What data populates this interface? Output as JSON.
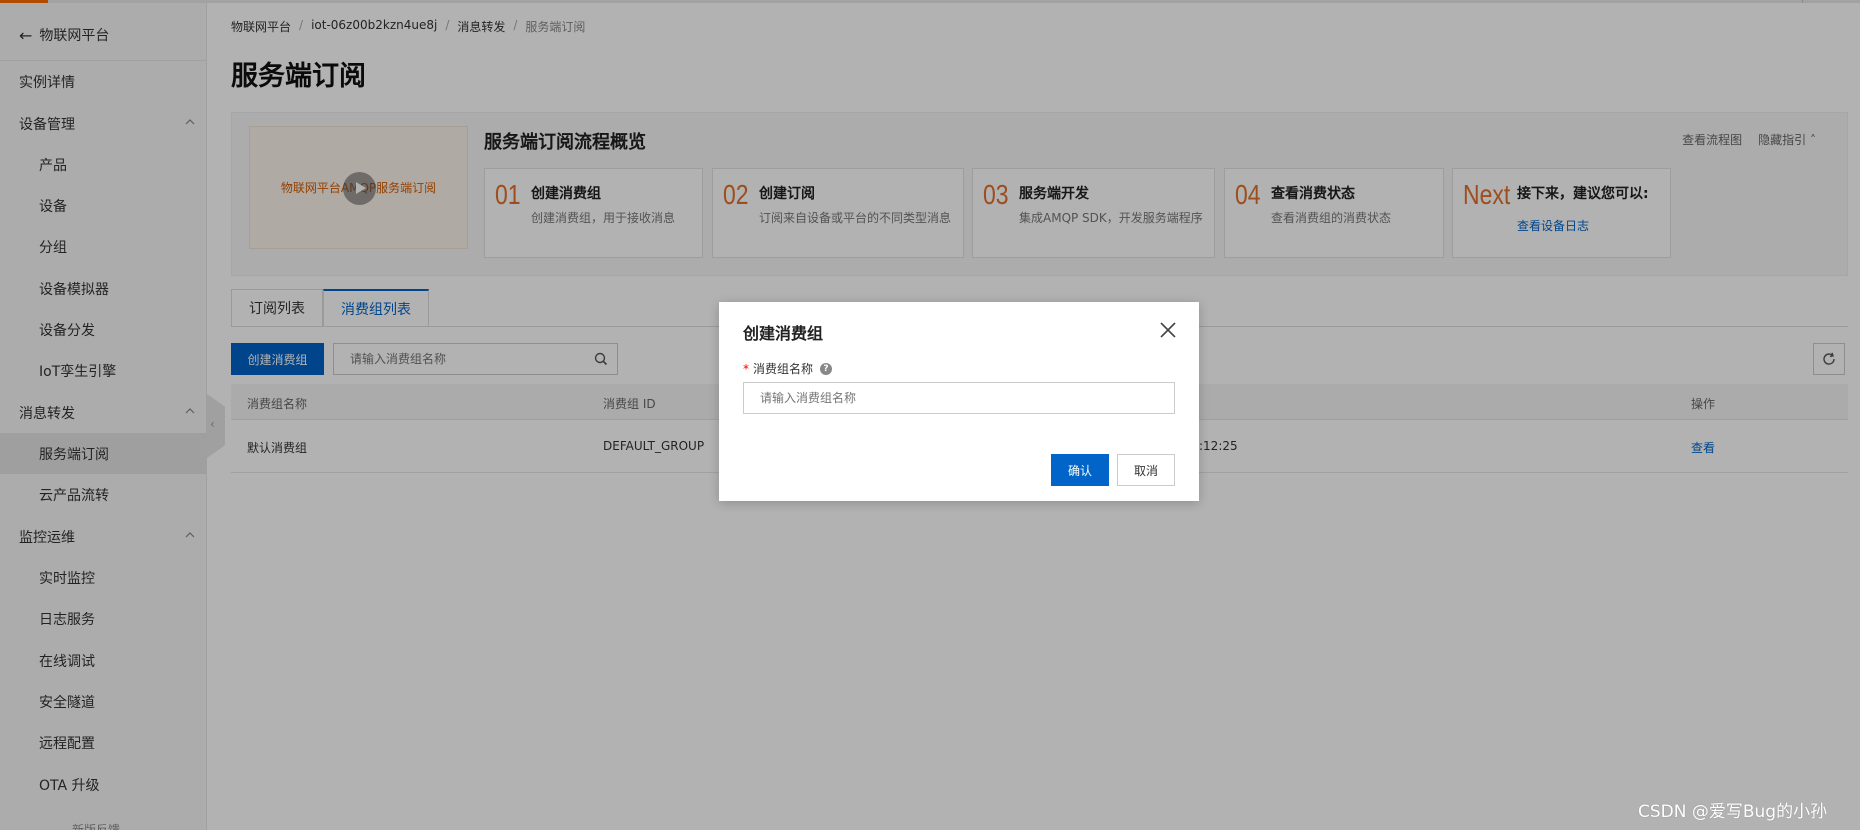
{
  "sidebar": {
    "back_label": "物联网平台",
    "items": [
      {
        "label": "实例详情"
      },
      {
        "label": "设备管理"
      },
      {
        "label": "产品"
      },
      {
        "label": "设备"
      },
      {
        "label": "分组"
      },
      {
        "label": "设备模拟器"
      },
      {
        "label": "设备分发"
      },
      {
        "label": "IoT孪生引擎"
      },
      {
        "label": "消息转发"
      },
      {
        "label": "服务端订阅"
      },
      {
        "label": "云产品流转"
      },
      {
        "label": "监控运维"
      },
      {
        "label": "实时监控"
      },
      {
        "label": "日志服务"
      },
      {
        "label": "在线调试"
      },
      {
        "label": "安全隧道"
      },
      {
        "label": "远程配置"
      },
      {
        "label": "OTA 升级"
      }
    ],
    "feedback": "新版反馈"
  },
  "breadcrumb": [
    "物联网平台",
    "iot-06z00b2kzn4ue8j",
    "消息转发",
    "服务端订阅"
  ],
  "page_title": "服务端订阅",
  "guide": {
    "video_caption": "物联网平台AMQP服务端订阅",
    "title": "服务端订阅流程概览",
    "link_flowchart": "查看流程图",
    "link_hide": "隐藏指引",
    "steps": [
      {
        "num": "01",
        "title": "创建消费组",
        "desc": "创建消费组，用于接收消息"
      },
      {
        "num": "02",
        "title": "创建订阅",
        "desc": "订阅来自设备或平台的不同类型消息"
      },
      {
        "num": "03",
        "title": "服务端开发",
        "desc": "集成AMQP SDK，开发服务端程序"
      },
      {
        "num": "04",
        "title": "查看消费状态",
        "desc": "查看消费组的消费状态"
      }
    ],
    "next": {
      "num": "Next",
      "title": "接下来，建议您可以:",
      "link": "查看设备日志"
    }
  },
  "tabs": [
    {
      "label": "订阅列表"
    },
    {
      "label": "消费组列表"
    }
  ],
  "toolbar": {
    "create_label": "创建消费组",
    "search_placeholder": "请输入消费组名称"
  },
  "table": {
    "headers": {
      "name": "消费组名称",
      "id": "消费组 ID",
      "action": "操作"
    },
    "rows": [
      {
        "name": "默认消费组",
        "id": "DEFAULT_GROUP",
        "time_fragment": ":12:25",
        "action": "查看"
      }
    ]
  },
  "dialog": {
    "title": "创建消费组",
    "field_label": "消费组名称",
    "field_placeholder": "请输入消费组名称",
    "ok_label": "确认",
    "cancel_label": "取消"
  },
  "watermark": "CSDN @爱写Bug的小孙"
}
